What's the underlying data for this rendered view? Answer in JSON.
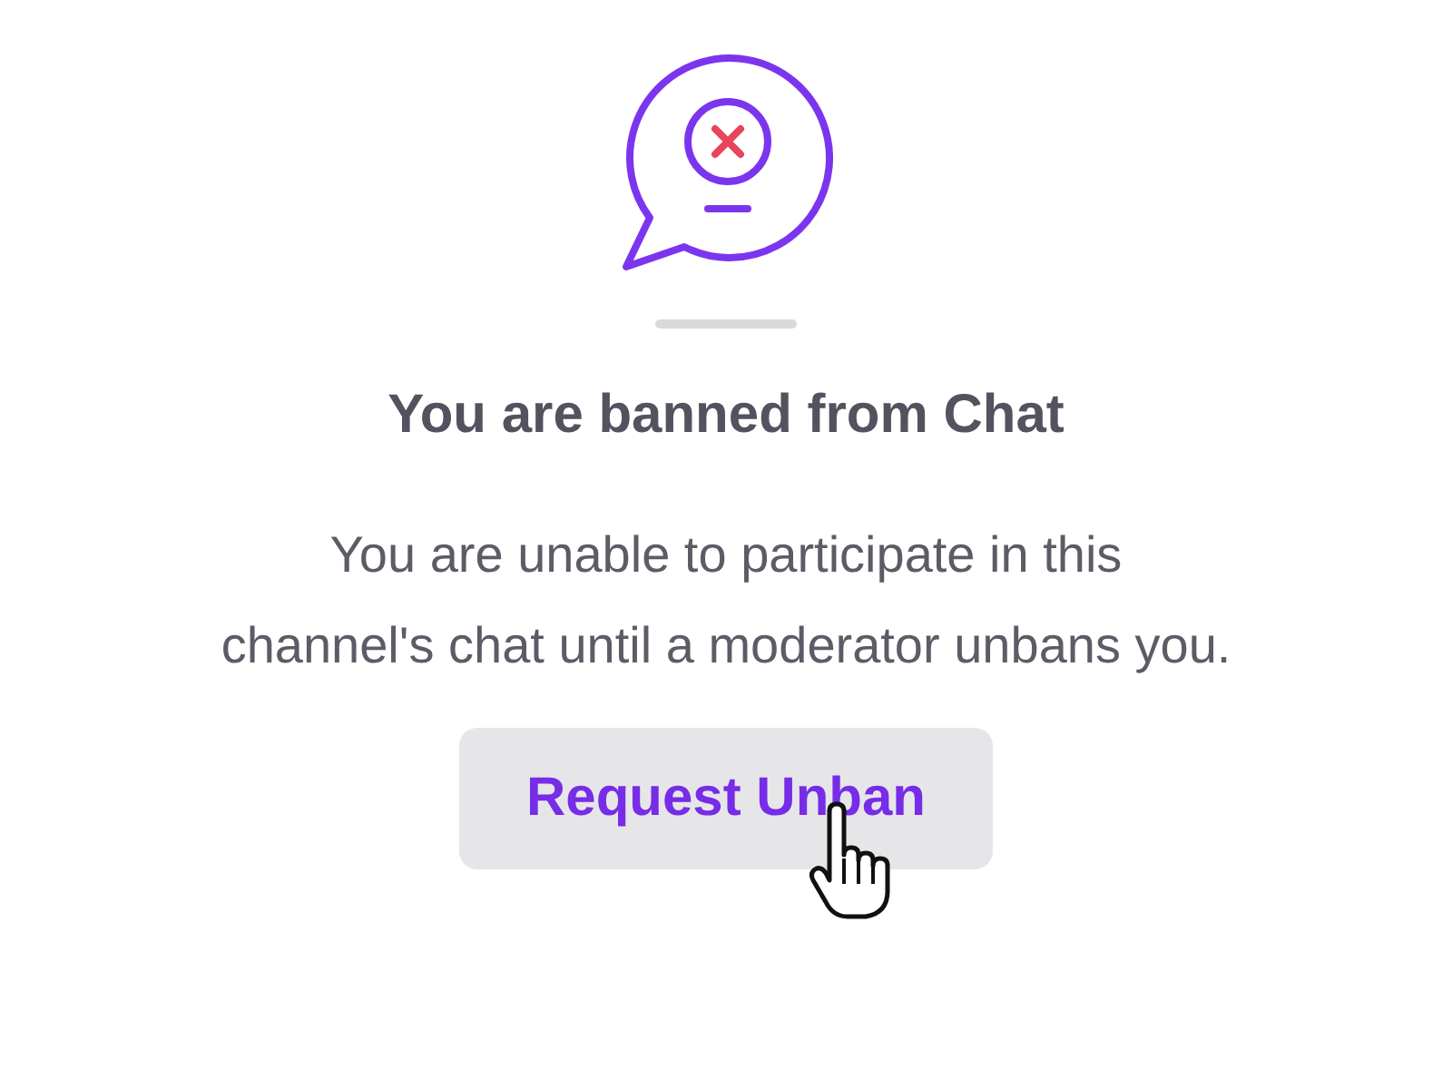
{
  "title": "You are banned from Chat",
  "message": "You are unable to participate in this channel's chat until a moderator unbans you.",
  "button": {
    "label": "Request Unban"
  }
}
